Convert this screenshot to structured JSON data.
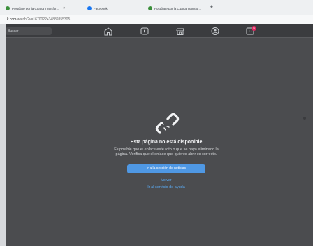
{
  "browser": {
    "tabs": [
      {
        "label": "Postúlate por la Cuarta Transfor...",
        "favicon_color": "#3b8f3b"
      },
      {
        "label": "Facebook",
        "favicon_color": "#1877f2"
      },
      {
        "label": "Postúlate por la Cuarta Transfor...",
        "favicon_color": "#3b8f3b"
      }
    ],
    "tab_close_glyph": "×",
    "new_tab_glyph": "+",
    "url": {
      "domain": "k.com",
      "path": "/watch/?v=1670022434889355305"
    }
  },
  "facebook": {
    "search_placeholder": "Buscar",
    "nav": [
      {
        "icon": "home-icon"
      },
      {
        "icon": "video-icon"
      },
      {
        "icon": "marketplace-icon"
      },
      {
        "icon": "groups-icon"
      },
      {
        "icon": "gaming-icon"
      }
    ],
    "notification_badge": "9",
    "error": {
      "icon": "broken-link-icon",
      "title": "Esta página no está disponible",
      "description": "Es posible que el enlace esté roto o que se haya eliminado la página. Verifica que el enlace que quieres abrir es correcto.",
      "primary_button": "Ir a la sección de noticias",
      "back_link": "Volver",
      "help_link": "Ir al servicio de ayuda"
    }
  },
  "colors": {
    "page_bg": "#4b4c4f",
    "nav_bg": "#3b3c3f",
    "button": "#4f98e4",
    "link": "#5aa8ef",
    "badge": "#e0245e"
  }
}
